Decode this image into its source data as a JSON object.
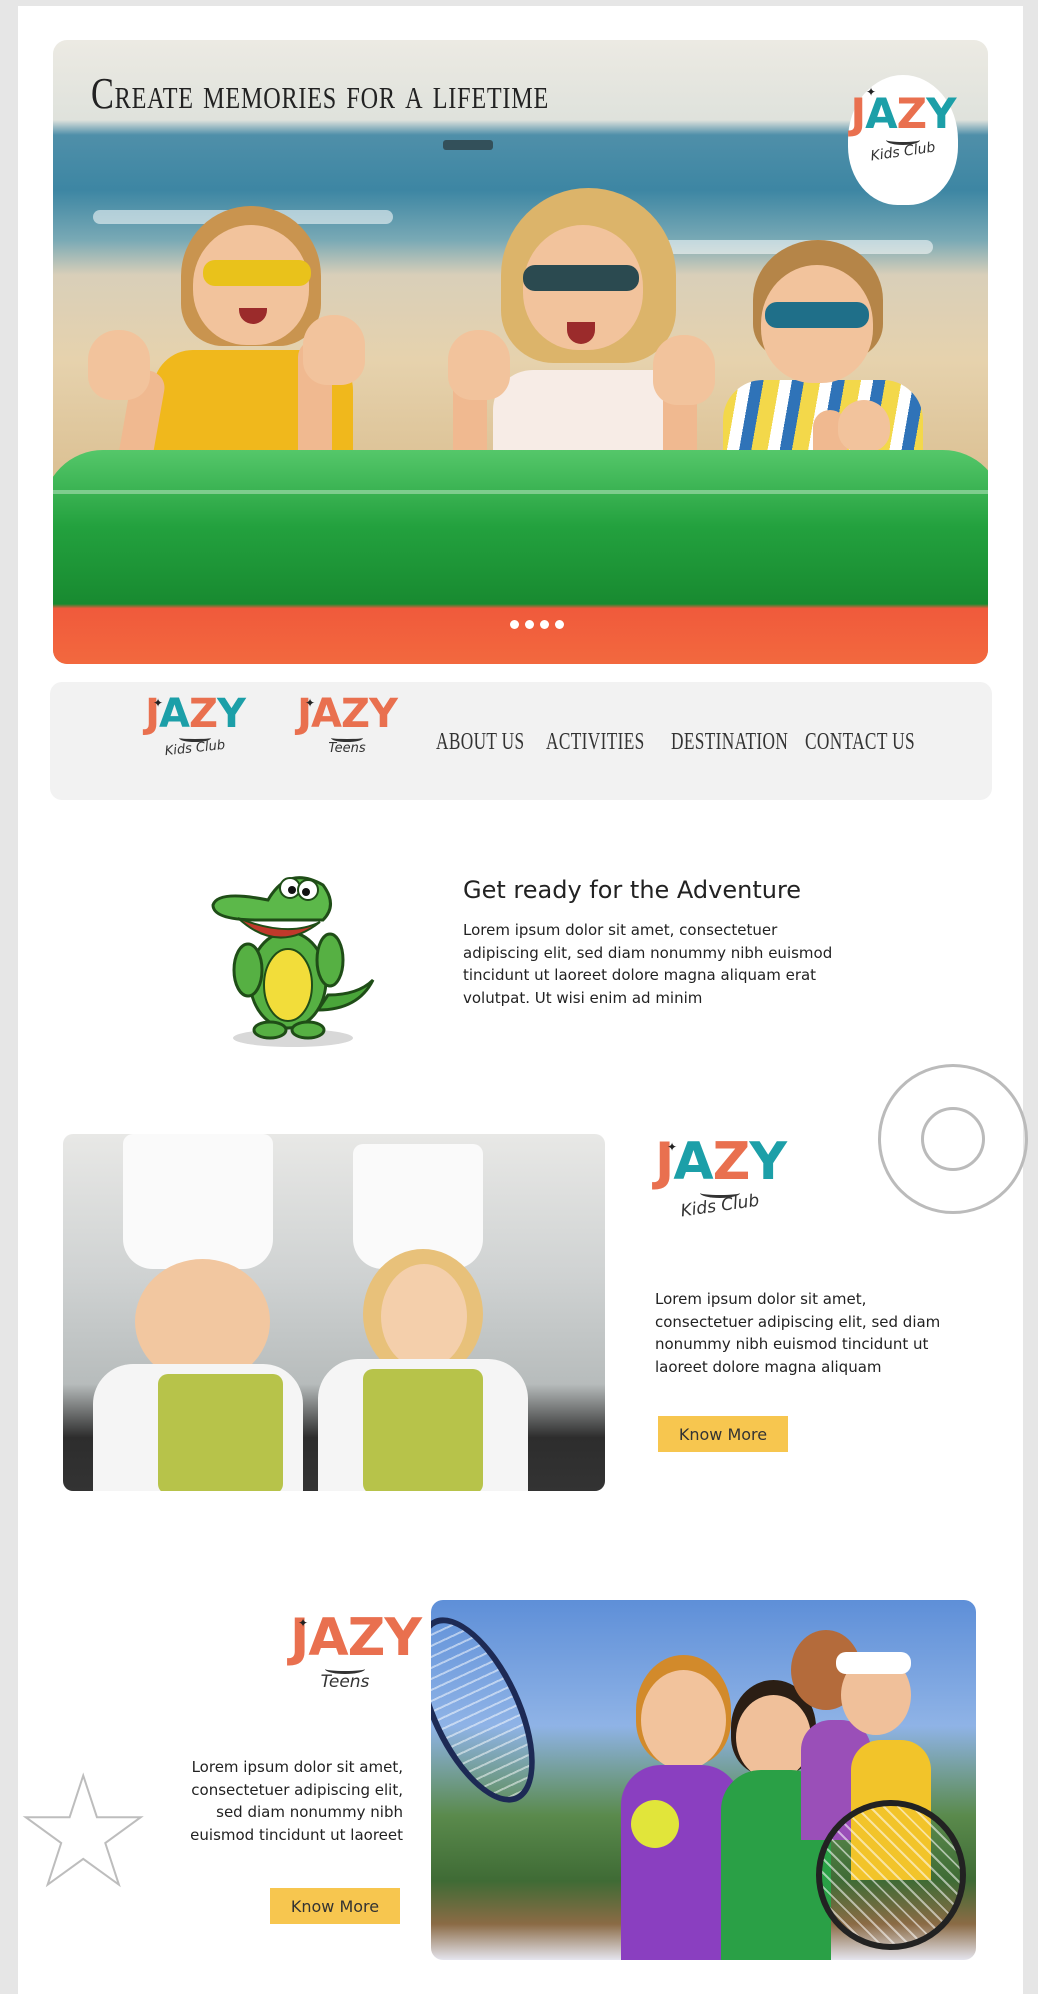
{
  "hero": {
    "title": "Create memories for a lifetime",
    "slide_dots": 4
  },
  "brand": {
    "kids_club": {
      "word": [
        "J",
        "A",
        "Z",
        "Y"
      ],
      "sub": "Kids Club"
    },
    "teens": {
      "word": [
        "J",
        "A",
        "Z",
        "Y"
      ],
      "sub": "Teens"
    }
  },
  "nav": {
    "items": [
      "ABOUT US",
      "ACTIVITIES",
      "DESTINATION",
      "CONTACT US"
    ]
  },
  "adventure": {
    "title": "Get ready for the Adventure",
    "text": "Lorem ipsum dolor sit amet, consectetuer adipiscing elit, sed diam nonummy nibh euismod tincidunt ut laoreet dolore magna aliquam erat volutpat. Ut wisi enim ad minim"
  },
  "kids_section": {
    "text": "Lorem ipsum dolor sit amet, consectetuer adipiscing elit, sed diam nonummy nibh euismod tincidunt ut laoreet dolore magna aliquam",
    "button": "Know More"
  },
  "teens_section": {
    "text": "Lorem ipsum dolor sit amet, consectetuer adipiscing elit, sed diam nonummy nibh euismod tincidunt ut laoreet",
    "button": "Know More"
  },
  "colors": {
    "accent_button": "#f7c64f",
    "brand_orange": "#e9704f",
    "brand_teal": "#1c9fa8",
    "nav_bg": "#f2f2f2"
  }
}
